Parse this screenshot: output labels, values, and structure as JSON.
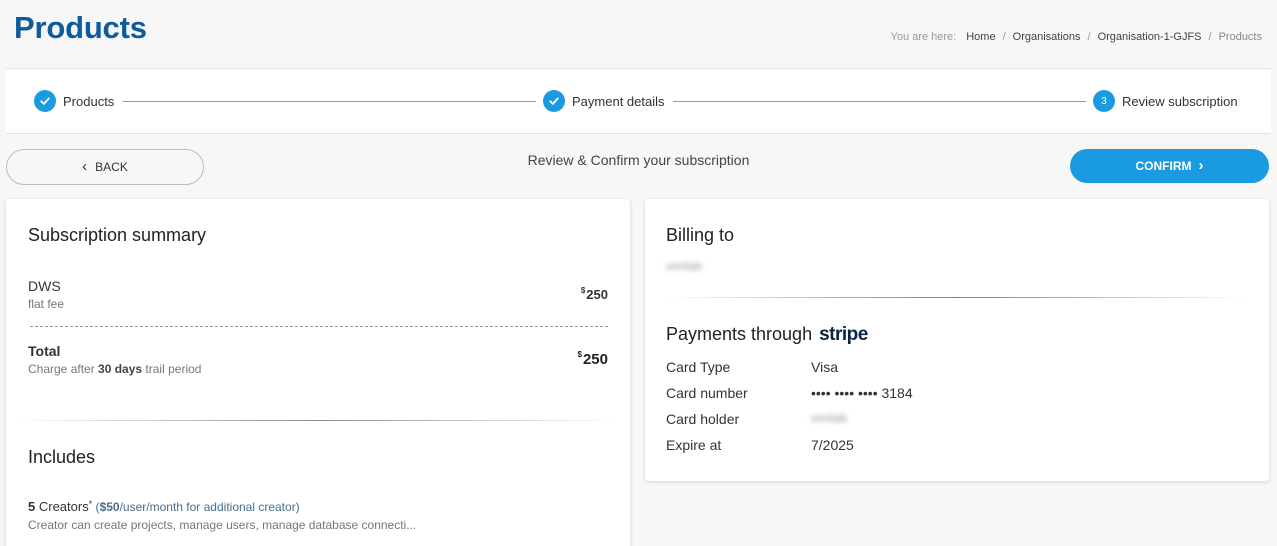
{
  "header": {
    "title": "Products",
    "breadcrumb": {
      "prefix": "You are here:",
      "items": [
        "Home",
        "Organisations",
        "Organisation-1-GJFS"
      ],
      "current": "Products"
    }
  },
  "stepper": {
    "steps": [
      {
        "label": "Products",
        "status": "done",
        "icon": "check-icon"
      },
      {
        "label": "Payment details",
        "status": "done",
        "icon": "check-icon"
      },
      {
        "label": "Review subscription",
        "status": "active",
        "number": "3"
      }
    ]
  },
  "actions": {
    "back_label": "BACK",
    "review_title": "Review & Confirm your subscription",
    "confirm_label": "CONFIRM"
  },
  "summary": {
    "title": "Subscription summary",
    "item": {
      "name": "DWS",
      "subtitle": "flat fee",
      "currency": "$",
      "price": "250"
    },
    "total": {
      "label": "Total",
      "sub_prefix": "Charge after ",
      "sub_bold": "30 days",
      "sub_suffix": " trail period",
      "currency": "$",
      "price": "250"
    },
    "includes": {
      "title": "Includes",
      "creators_count": "5",
      "creators_label": " Creators",
      "creators_star": "*",
      "extra_open": " (",
      "extra_price": "$50",
      "extra_text": "/user/month for additional creator)",
      "description": "Creator can create projects, manage users, manage database connecti..."
    }
  },
  "billing": {
    "title": "Billing to",
    "name_redacted": "veritab",
    "payments_title": "Payments through",
    "payment_provider": "stripe",
    "rows": [
      {
        "label": "Card Type",
        "value": "Visa"
      },
      {
        "label": "Card number",
        "value": "•••• •••• •••• 3184"
      },
      {
        "label": "Card holder",
        "value": "veritab"
      },
      {
        "label": "Expire at",
        "value": "7/2025"
      }
    ]
  },
  "colors": {
    "title": "#0d5a9c",
    "accent": "#1a9ae0",
    "background": "#f7f7f7"
  }
}
